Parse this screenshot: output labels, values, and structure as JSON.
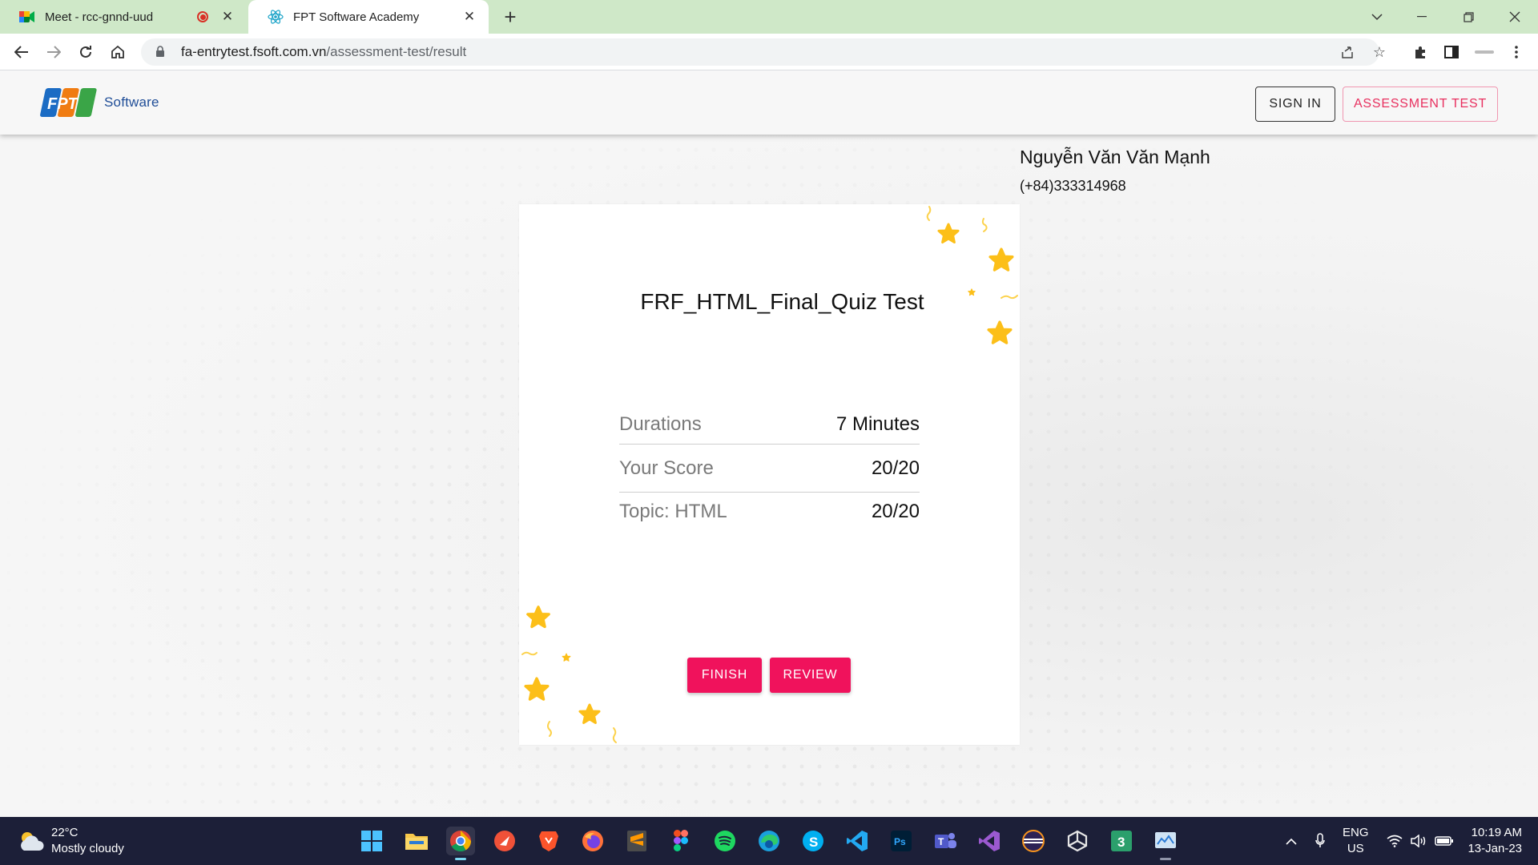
{
  "browser": {
    "tabs": [
      {
        "title": "Meet - rcc-gnnd-uud",
        "active": false
      },
      {
        "title": "FPT Software Academy",
        "active": true
      }
    ],
    "url_host": "fa-entrytest.fsoft.com.vn",
    "url_path": "/assessment-test/result"
  },
  "header": {
    "logo_text": "FPT",
    "logo_suffix": "Software",
    "sign_in_label": "SIGN IN",
    "assessment_label": "ASSESSMENT TEST"
  },
  "user": {
    "name": "Nguyễn Văn Văn Mạnh",
    "phone": "(+84)333314968"
  },
  "result": {
    "title": "FRF_HTML_Final_Quiz Test",
    "rows": [
      {
        "label": "Durations",
        "value": "7 Minutes"
      },
      {
        "label": "Your Score",
        "value": "20/20"
      },
      {
        "label": "Topic: HTML",
        "value": "20/20"
      }
    ],
    "finish_label": "FINISH",
    "review_label": "REVIEW"
  },
  "colors": {
    "accent": "#f0125c",
    "star": "#fcbf19",
    "taskbar": "#1c1f38"
  },
  "taskbar": {
    "weather_temp": "22°C",
    "weather_desc": "Mostly cloudy",
    "lang_line1": "ENG",
    "lang_line2": "US",
    "time": "10:19 AM",
    "date": "13-Jan-23",
    "apps": [
      "start-icon",
      "file-explorer-icon",
      "chrome-icon",
      "swift-icon",
      "brave-icon",
      "firefox-icon",
      "sublime-icon",
      "figma-icon",
      "spotify-icon",
      "edge-icon",
      "skype-icon",
      "vscode-icon",
      "photoshop-icon",
      "teams-icon",
      "visual-studio-icon",
      "eclipse-icon",
      "unity-icon",
      "app-3-icon",
      "monitor-icon"
    ]
  }
}
